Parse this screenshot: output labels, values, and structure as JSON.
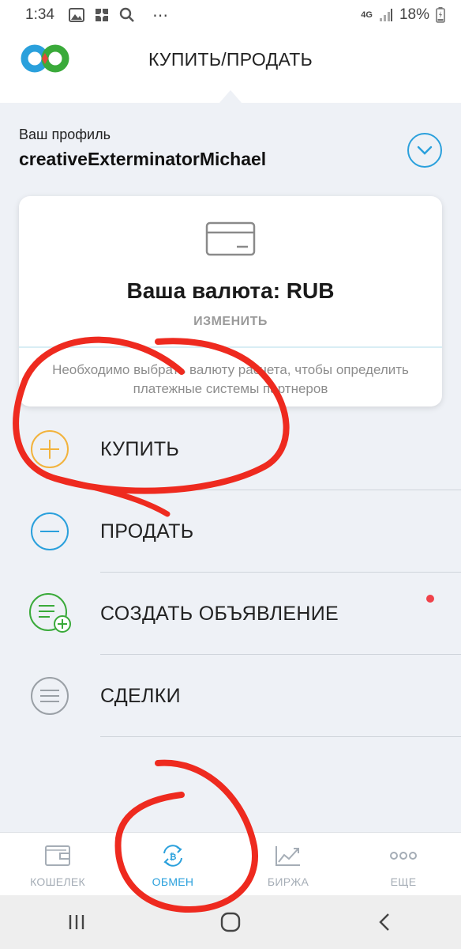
{
  "status_bar": {
    "time": "1:34",
    "more": "⋯",
    "network": "4G",
    "battery": "18%"
  },
  "header": {
    "title": "КУПИТЬ/ПРОДАТЬ"
  },
  "profile": {
    "label": "Ваш профиль",
    "name": "creativeExterminatorMichael"
  },
  "currency_card": {
    "title": "Ваша валюта: RUB",
    "change_label": "ИЗМЕНИТЬ",
    "note": "Необходимо выбрать валюту расчета, чтобы определить платежные системы партнеров"
  },
  "actions": [
    {
      "label": "КУПИТЬ",
      "icon": "plus-circle-icon",
      "color": "#f2b33d"
    },
    {
      "label": "ПРОДАТЬ",
      "icon": "minus-circle-icon",
      "color": "#2aa0dc"
    },
    {
      "label": "СОЗДАТЬ ОБЪЯВЛЕНИЕ",
      "icon": "create-ad-icon",
      "color": "#3aaa3a"
    },
    {
      "label": "СДЕЛКИ",
      "icon": "deals-icon",
      "color": "#9aa0a6"
    }
  ],
  "bottom_nav": [
    {
      "label": "КОШЕЛЕК",
      "icon": "wallet-icon"
    },
    {
      "label": "ОБМЕН",
      "icon": "exchange-icon",
      "active": true
    },
    {
      "label": "БИРЖА",
      "icon": "chart-icon"
    },
    {
      "label": "ЕЩЕ",
      "icon": "more-icon"
    }
  ],
  "colors": {
    "accent": "#2aa0dc",
    "buy": "#f2b33d",
    "create": "#3aaa3a",
    "notification": "#f0424a",
    "annotation": "#ee2a1f"
  }
}
